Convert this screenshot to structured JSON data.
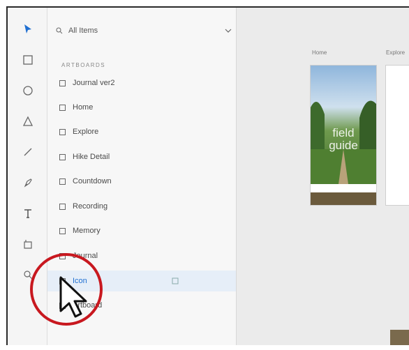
{
  "search": {
    "label": "All Items"
  },
  "section_title": "ARTBOARDS",
  "layers": [
    {
      "label": "Journal ver2"
    },
    {
      "label": "Home"
    },
    {
      "label": "Explore"
    },
    {
      "label": "Hike Detail"
    },
    {
      "label": "Countdown"
    },
    {
      "label": "Recording"
    },
    {
      "label": "Memory"
    },
    {
      "label": "Journal"
    },
    {
      "label": "Icon"
    },
    {
      "label": "Artboard"
    }
  ],
  "canvas": {
    "artboard_home_label": "Home",
    "artboard_explore_label": "Explore",
    "hero_line1": "field",
    "hero_line2": "guide"
  },
  "colors": {
    "accent": "#1f6fd1",
    "highlight_circle": "#c8181f"
  }
}
